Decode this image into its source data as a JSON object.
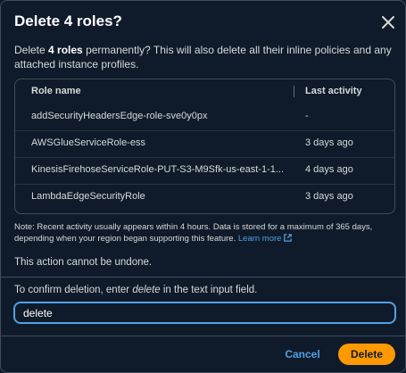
{
  "dialog": {
    "title": "Delete 4 roles?",
    "close_icon": "close-icon"
  },
  "description": {
    "prefix": "Delete ",
    "count_bold": "4 roles",
    "suffix": " permanently? This will also delete all their inline policies and any attached instance profiles."
  },
  "table": {
    "headers": {
      "name": "Role name",
      "activity": "Last activity"
    },
    "rows": [
      {
        "name": "addSecurityHeadersEdge-role-sve0y0px",
        "activity": "-"
      },
      {
        "name": "AWSGlueServiceRole-ess",
        "activity": "3 days ago"
      },
      {
        "name": "KinesisFirehoseServiceRole-PUT-S3-M9Sfk-us-east-1-1...",
        "activity": "4 days ago"
      },
      {
        "name": "LambdaEdgeSecurityRole",
        "activity": "3 days ago"
      }
    ]
  },
  "note": {
    "text": "Note: Recent activity usually appears within 4 hours. Data is stored for a maximum of 365 days, depending when your region began supporting this feature. ",
    "link": "Learn more",
    "link_icon": "external-link-icon"
  },
  "warning": "This action cannot be undone.",
  "confirm": {
    "prefix": "To confirm deletion, enter ",
    "keyword": "delete",
    "suffix": " in the text input field.",
    "input_value": "delete"
  },
  "footer": {
    "cancel_label": "Cancel",
    "delete_label": "Delete"
  },
  "colors": {
    "background": "#0f1b2a",
    "border": "#414d5c",
    "link": "#539fe5",
    "primary_button": "#ff9900"
  }
}
